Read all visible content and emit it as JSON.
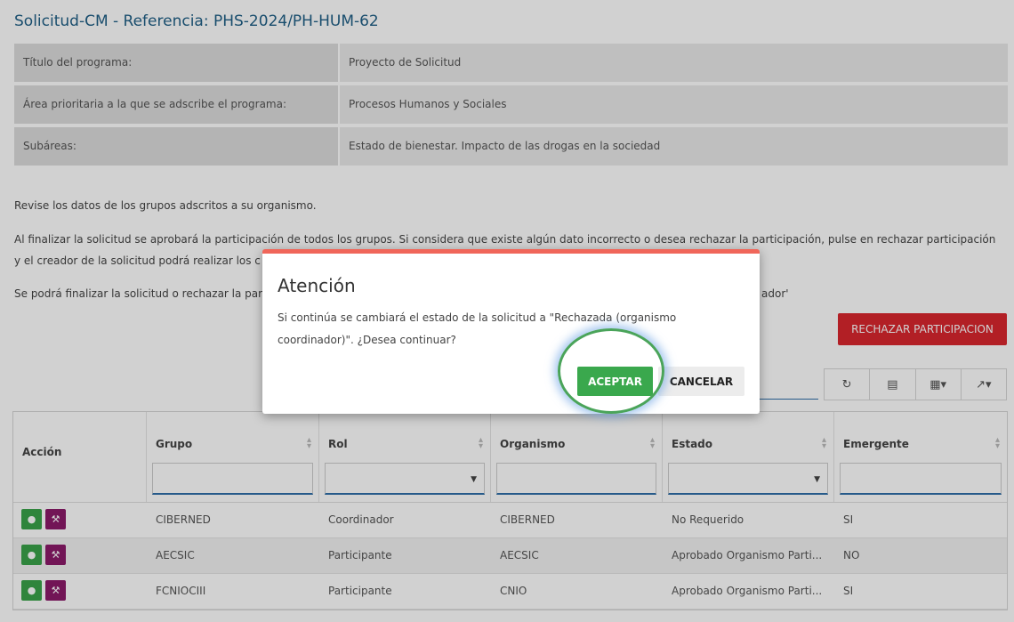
{
  "page": {
    "title": "Solicitud-CM - Referencia: PHS-2024/PH-HUM-62"
  },
  "info": [
    {
      "label": "Título del programa:",
      "value": "Proyecto de Solicitud"
    },
    {
      "label": "Área prioritaria a la que se adscribe el programa:",
      "value": "Procesos Humanos y Sociales"
    },
    {
      "label": "Subáreas:",
      "value": "Estado de bienestar. Impacto de las drogas en la sociedad"
    }
  ],
  "paragraphs": {
    "p1": "Revise los datos de los grupos adscritos a su organismo.",
    "p2a": "Al finalizar la solicitud se aprobará la participación de todos los grupos. Si considera que existe algún dato incorrecto o desea rechazar la participación, pulse en rechazar participación",
    "p2b_left": "y el creador de la solicitud podrá realizar los c",
    "p3_left": "Se podrá finalizar la solicitud o rechazar la par",
    "p3_right": "ador'"
  },
  "actions": {
    "reject_label": "RECHAZAR PARTICIPACION"
  },
  "toolbar": {
    "refresh_icon": "refresh-icon",
    "list_icon": "list-icon",
    "columns_icon": "columns-icon",
    "export_icon": "export-icon"
  },
  "table": {
    "headers": [
      "Acción",
      "Grupo",
      "Rol",
      "Organismo",
      "Estado",
      "Emergente"
    ],
    "rows": [
      {
        "grupo": "CIBERNED",
        "rol": "Coordinador",
        "organismo": "CIBERNED",
        "estado": "No Requerido",
        "emergente": "SI"
      },
      {
        "grupo": "AECSIC",
        "rol": "Participante",
        "organismo": "AECSIC",
        "estado": "Aprobado Organismo Parti...",
        "emergente": "NO"
      },
      {
        "grupo": "FCNIOCIII",
        "rol": "Participante",
        "organismo": "CNIO",
        "estado": "Aprobado Organismo Parti...",
        "emergente": "SI"
      }
    ]
  },
  "modal": {
    "title": "Atención",
    "line1": "Si continúa se cambiará el estado de la solicitud a \"Rechazada (organismo",
    "line2": "coordinador)\". ¿Desea continuar?",
    "accept_label": "ACEPTAR",
    "cancel_label": "CANCELAR"
  },
  "colors": {
    "accent": "#1f5f86",
    "danger": "#d9262e",
    "success": "#3aa84d",
    "tool_purple": "#8c1a6a",
    "modal_top": "#f0665a"
  }
}
